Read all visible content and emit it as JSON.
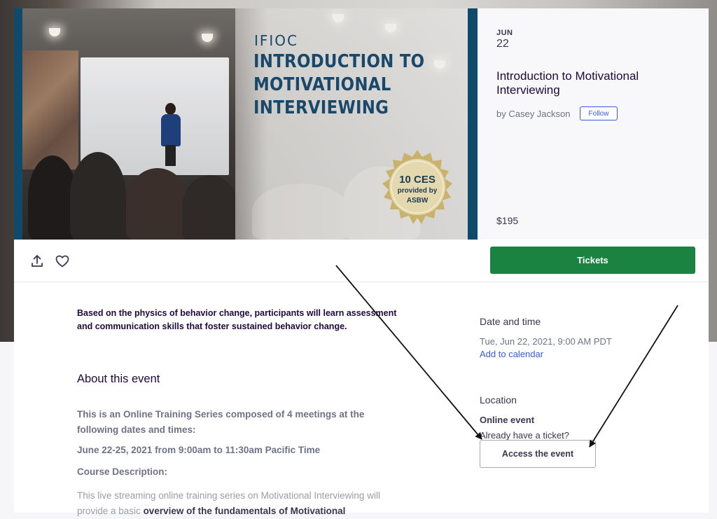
{
  "hero": {
    "org": "IFIOC",
    "title_lines": [
      "INTRODUCTION TO",
      "MOTIVATIONAL",
      "INTERVIEWING"
    ],
    "seal_ces": "10 CES",
    "seal_sub1": "provided by",
    "seal_sub2": "ASBW"
  },
  "event": {
    "month": "JUN",
    "day": "22",
    "title": "Introduction to Motivational Interviewing",
    "organizer": "by Casey Jackson",
    "follow_label": "Follow",
    "price": "$195"
  },
  "actions": {
    "share_icon": "share-icon",
    "like_icon": "heart-icon",
    "tickets_label": "Tickets"
  },
  "body": {
    "summary": "Based on the physics of behavior change, participants will learn assessment and communication skills that foster sustained behavior change.",
    "about_heading": "About this event",
    "p1": "This is an Online Training Series composed of 4 meetings at the following dates and times:",
    "p2": "June 22-25, 2021 from 9:00am to 11:30am Pacific Time",
    "p3": "Course Description:",
    "p4_start": "This live streaming online training series on Motivational Interviewing will provide a basic ",
    "p4_bold": "overview of the fundamentals of Motivational"
  },
  "sidebar": {
    "date_heading": "Date and time",
    "date_value": "Tue, Jun 22, 2021, 9:00 AM PDT",
    "calendar_link": "Add to calendar",
    "location_heading": "Location",
    "location_value": "Online event",
    "ticket_question": "Already have a ticket?",
    "access_label": "Access the event"
  },
  "colors": {
    "brand_blue": "#19486b",
    "tickets_green": "#1a8342",
    "link_blue": "#3659e3"
  }
}
